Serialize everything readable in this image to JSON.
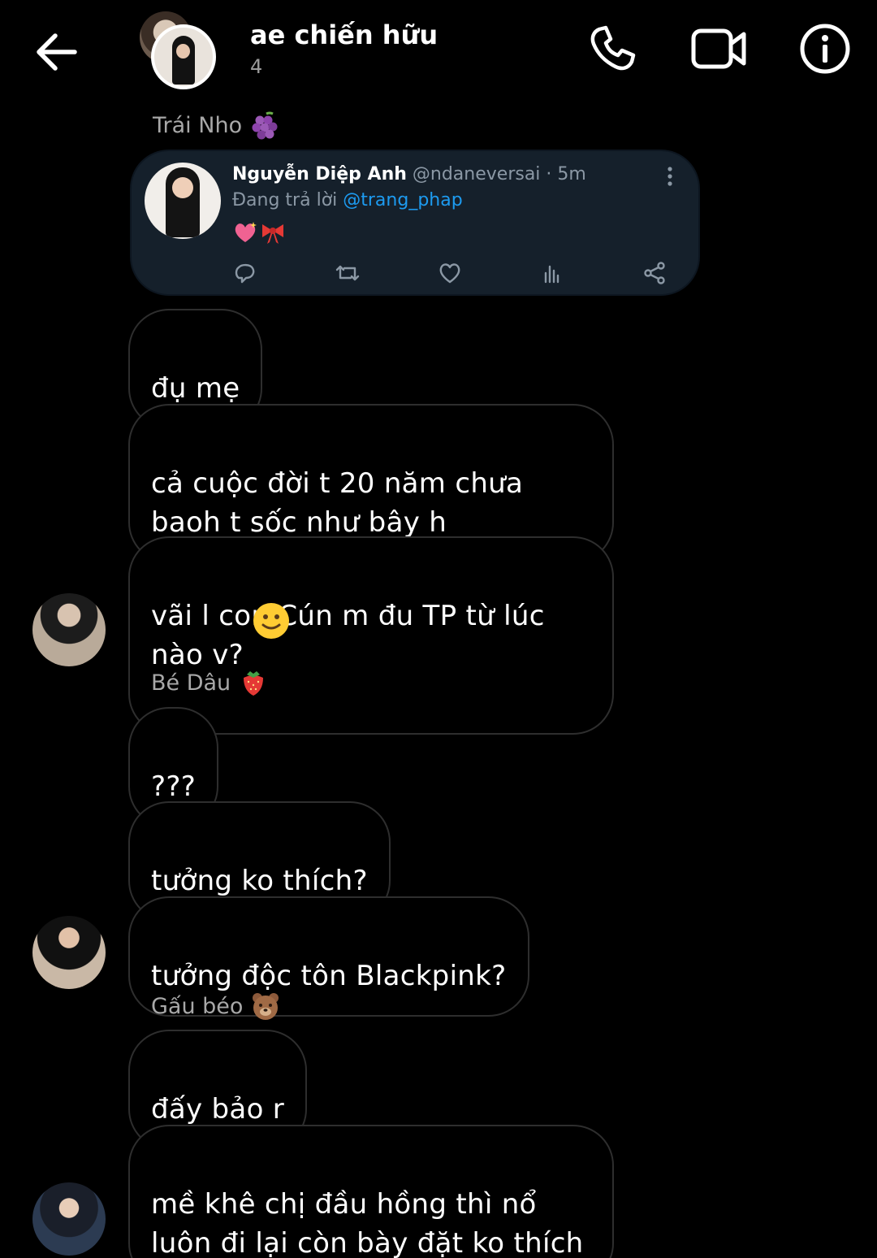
{
  "header": {
    "title": "ae chiến hữu",
    "member_count": "4",
    "icons": [
      "back-arrow-icon",
      "phone-icon",
      "video-camera-icon",
      "info-icon"
    ]
  },
  "senders": {
    "first": "Trái Nho",
    "second": "Bé Dâu",
    "third": "Gấu béo"
  },
  "tweet": {
    "name": "Nguyễn Diệp Anh",
    "handle": "@ndaneversai · 5m",
    "reply_prefix": "Đang trả lời",
    "reply_mention": "@trang_phap",
    "accent": "#1d9bf0",
    "background": "#15202b"
  },
  "messages": [
    "đụ mẹ",
    "cả cuộc đời t 20 năm chưa\nbaoh t sốc như bây h",
    "vãi l con Cún m đu TP từ lúc\nnào v?",
    "???",
    "tưởng ko thích?",
    "tưởng độc tôn Blackpink?",
    "đấy bảo r",
    "mề khê chị đầu hồng thì nổ\nluôn đi lại còn bày đặt ko thích"
  ]
}
